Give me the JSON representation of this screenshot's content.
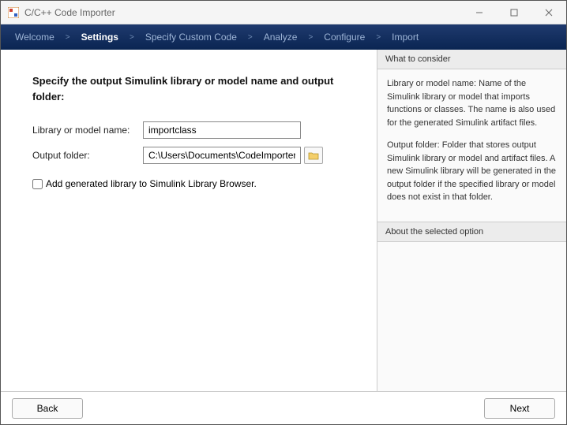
{
  "window": {
    "title": "C/C++ Code Importer"
  },
  "breadcrumb": {
    "steps": [
      "Welcome",
      "Settings",
      "Specify Custom Code",
      "Analyze",
      "Configure",
      "Import"
    ],
    "active_index": 1
  },
  "main": {
    "heading": "Specify the output Simulink library or model name and output folder:",
    "library_label": "Library or model name:",
    "library_value": "importclass",
    "output_label": "Output folder:",
    "output_value": "C:\\Users\\Documents\\CodeImporter",
    "checkbox_label": "Add generated library to Simulink Library Browser."
  },
  "side": {
    "consider_header": "What to consider",
    "consider_p1": "Library or model name: Name of the Simulink library or model that imports functions or classes. The name is also used for the generated Simulink artifact files.",
    "consider_p2": "Output folder: Folder that stores output Simulink library or model and artifact files. A new Simulink library will be generated in the output folder if the specified library or model does not exist in that folder.",
    "about_header": "About the selected option"
  },
  "footer": {
    "back": "Back",
    "next": "Next"
  }
}
